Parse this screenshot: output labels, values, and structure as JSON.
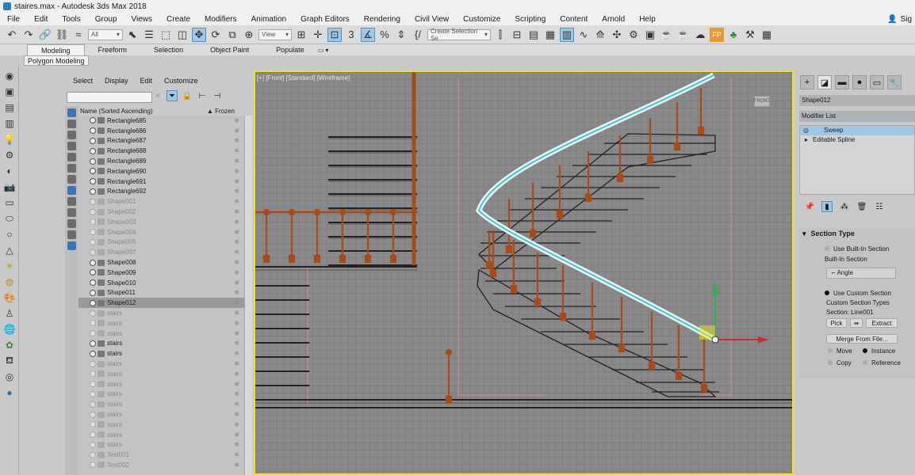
{
  "window": {
    "title": "staires.max - Autodesk 3ds Max 2018",
    "signin": "Sig"
  },
  "menu": [
    "File",
    "Edit",
    "Tools",
    "Group",
    "Views",
    "Create",
    "Modifiers",
    "Animation",
    "Graph Editors",
    "Rendering",
    "Civil View",
    "Customize",
    "Scripting",
    "Content",
    "Arnold",
    "Help"
  ],
  "toolbar": {
    "filter": "All",
    "refcoord": "View",
    "selset": "Create Selection Se"
  },
  "ribbon": {
    "tabs": [
      "Modeling",
      "Freeform",
      "Selection",
      "Object Paint",
      "Populate"
    ],
    "active": "Modeling",
    "panel": "Polygon Modeling"
  },
  "scene": {
    "menu": [
      "Select",
      "Display",
      "Edit",
      "Customize"
    ],
    "col_name": "Name (Sorted Ascending)",
    "col_frozen": "Frozen",
    "sort_indicator": "▲",
    "rows": [
      {
        "name": "Rectangle685",
        "dim": false,
        "sel": false
      },
      {
        "name": "Rectangle686",
        "dim": false,
        "sel": false
      },
      {
        "name": "Rectangle687",
        "dim": false,
        "sel": false
      },
      {
        "name": "Rectangle688",
        "dim": false,
        "sel": false
      },
      {
        "name": "Rectangle689",
        "dim": false,
        "sel": false
      },
      {
        "name": "Rectangle690",
        "dim": false,
        "sel": false
      },
      {
        "name": "Rectangle691",
        "dim": false,
        "sel": false
      },
      {
        "name": "Rectangle692",
        "dim": false,
        "sel": false
      },
      {
        "name": "Shape001",
        "dim": true,
        "sel": false
      },
      {
        "name": "Shape002",
        "dim": true,
        "sel": false
      },
      {
        "name": "Shape003",
        "dim": true,
        "sel": false
      },
      {
        "name": "Shape004",
        "dim": true,
        "sel": false
      },
      {
        "name": "Shape005",
        "dim": true,
        "sel": false
      },
      {
        "name": "Shape007",
        "dim": true,
        "sel": false
      },
      {
        "name": "Shape008",
        "dim": false,
        "sel": false
      },
      {
        "name": "Shape009",
        "dim": false,
        "sel": false
      },
      {
        "name": "Shape010",
        "dim": false,
        "sel": false
      },
      {
        "name": "Shape011",
        "dim": false,
        "sel": false
      },
      {
        "name": "Shape012",
        "dim": false,
        "sel": true
      },
      {
        "name": "stairs",
        "dim": true,
        "sel": false
      },
      {
        "name": "stairs",
        "dim": true,
        "sel": false
      },
      {
        "name": "stairs",
        "dim": true,
        "sel": false
      },
      {
        "name": "stairs",
        "dim": false,
        "sel": false
      },
      {
        "name": "stairs",
        "dim": false,
        "sel": false
      },
      {
        "name": "stairs",
        "dim": true,
        "sel": false
      },
      {
        "name": "stairs",
        "dim": true,
        "sel": false
      },
      {
        "name": "stairs",
        "dim": true,
        "sel": false
      },
      {
        "name": "stairs",
        "dim": true,
        "sel": false
      },
      {
        "name": "stairs",
        "dim": true,
        "sel": false
      },
      {
        "name": "stairs",
        "dim": true,
        "sel": false
      },
      {
        "name": "stairs",
        "dim": true,
        "sel": false
      },
      {
        "name": "stairs",
        "dim": true,
        "sel": false
      },
      {
        "name": "stairs",
        "dim": true,
        "sel": false
      },
      {
        "name": "Text001",
        "dim": true,
        "sel": false
      },
      {
        "name": "Text002",
        "dim": true,
        "sel": false
      }
    ]
  },
  "viewport": {
    "label": "[+] [Front] [Standard] [Wireframe]",
    "cube": "FRONT"
  },
  "command": {
    "object": "Shape012",
    "modlist": "Modifier List",
    "stack": [
      {
        "name": "Sweep",
        "sel": true
      },
      {
        "name": "Editable Spline",
        "sel": false
      }
    ],
    "section": {
      "title": "Section Type",
      "builtin": "Use Built-In Section",
      "builtin_label": "Built-In Section",
      "angle": "Angle",
      "custom": "Use Custom Section",
      "custom_types": "Custom Section Types",
      "section_name": "Section: Line001",
      "pick": "Pick",
      "extract": "Extract",
      "merge": "Merge From File...",
      "move": "Move",
      "instance": "Instance",
      "copy": "Copy",
      "reference": "Reference"
    }
  }
}
